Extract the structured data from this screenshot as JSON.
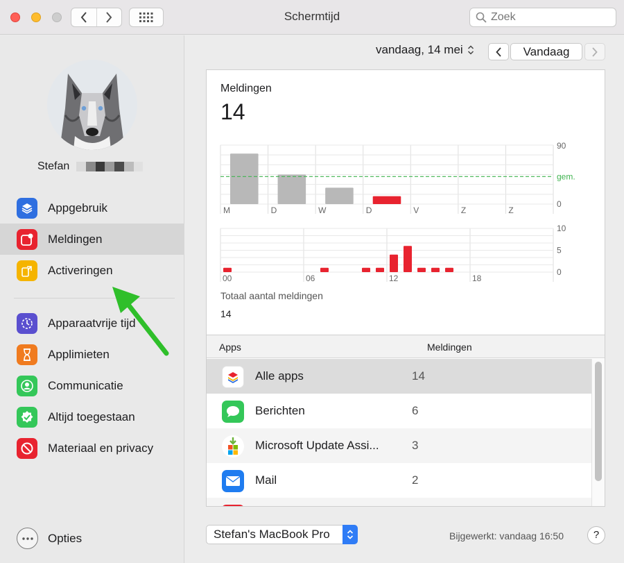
{
  "window": {
    "title": "Schermtijd"
  },
  "search": {
    "placeholder": "Zoek"
  },
  "user": {
    "name": "Stefan"
  },
  "sidebar": {
    "items": [
      {
        "label": "Appgebruik",
        "icon": "layers-icon",
        "color": "#2f6fe0"
      },
      {
        "label": "Meldingen",
        "icon": "notification-badge-icon",
        "color": "#e8232f"
      },
      {
        "label": "Activeringen",
        "icon": "pickup-phone-icon",
        "color": "#f5b400"
      },
      {
        "label": "Apparaatvrije tijd",
        "icon": "downtime-icon",
        "color": "#5a4fcf"
      },
      {
        "label": "Applimieten",
        "icon": "hourglass-icon",
        "color": "#f07b1f"
      },
      {
        "label": "Communicatie",
        "icon": "person-circle-icon",
        "color": "#34c759"
      },
      {
        "label": "Altijd toegestaan",
        "icon": "checkmark-badge-icon",
        "color": "#34c759"
      },
      {
        "label": "Materiaal en privacy",
        "icon": "prohibited-icon",
        "color": "#e8232f"
      }
    ],
    "options_label": "Opties"
  },
  "date": {
    "label": "vandaag, 14 mei",
    "today_label": "Vandaag"
  },
  "panel": {
    "title": "Meldingen",
    "count": "14",
    "total_label": "Totaal aantal meldingen",
    "total_value": "14"
  },
  "chart_data": [
    {
      "type": "bar",
      "categories": [
        "M",
        "D",
        "W",
        "D",
        "V",
        "Z",
        "Z"
      ],
      "values": [
        77,
        45,
        25,
        12,
        0,
        0,
        0
      ],
      "ylim": [
        0,
        90
      ],
      "yticks": [
        "90",
        "0"
      ],
      "average": {
        "label": "gem.",
        "value": 42
      },
      "highlight_index": 3
    },
    {
      "type": "bar",
      "x_ticks": [
        "00",
        "06",
        "12",
        "18"
      ],
      "hours": [
        0,
        1,
        2,
        3,
        4,
        5,
        6,
        7,
        8,
        9,
        10,
        11,
        12,
        13,
        14,
        15,
        16,
        17,
        18,
        19,
        20,
        21,
        22,
        23
      ],
      "values": [
        1,
        0,
        0,
        0,
        0,
        0,
        0,
        1,
        0,
        0,
        1,
        1,
        4,
        6,
        1,
        1,
        1,
        0,
        0,
        0,
        0,
        0,
        0,
        0
      ],
      "ylim": [
        0,
        10
      ],
      "yticks": [
        "10",
        "5",
        "0"
      ]
    }
  ],
  "table": {
    "col_apps": "Apps",
    "col_count": "Meldingen",
    "rows": [
      {
        "name": "Alle apps",
        "count": "14",
        "icon": "all-apps-icon"
      },
      {
        "name": "Berichten",
        "count": "6",
        "icon": "messages-icon"
      },
      {
        "name": "Microsoft Update Assi...",
        "count": "3",
        "icon": "microsoft-update-icon"
      },
      {
        "name": "Mail",
        "count": "2",
        "icon": "mail-icon"
      }
    ]
  },
  "footer": {
    "device": "Stefan's MacBook Pro",
    "updated": "Bijgewerkt: vandaag 16:50",
    "help": "?"
  },
  "colors": {
    "accent_red": "#e8232f",
    "bar_gray": "#b8b8b8",
    "average_green": "#3fb34f",
    "selection": "#d6d6d6"
  }
}
